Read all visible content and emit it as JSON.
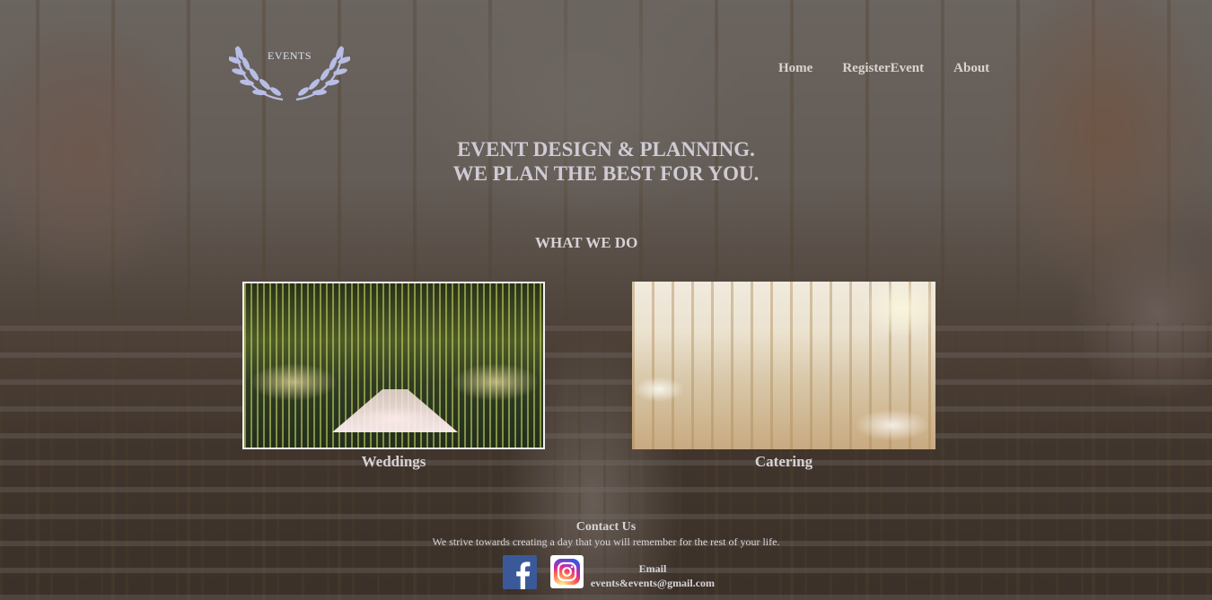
{
  "brand": {
    "logo_text": "EVENTS"
  },
  "nav": {
    "items": [
      "Home",
      "RegisterEvent",
      "About"
    ]
  },
  "hero": {
    "line1": "EVENT DESIGN & PLANNING.",
    "line2": "WE PLAN THE BEST FOR YOU."
  },
  "services": {
    "title": "WHAT WE DO",
    "items": [
      {
        "label": "Weddings"
      },
      {
        "label": "Catering"
      }
    ]
  },
  "contact": {
    "title": "Contact Us",
    "text": "We strive towards creating a day that you will remember for the rest of your life.",
    "social": [
      "facebook-icon",
      "instagram-icon"
    ],
    "email_label": "Email",
    "email_value": "events&events@gmail.com"
  }
}
